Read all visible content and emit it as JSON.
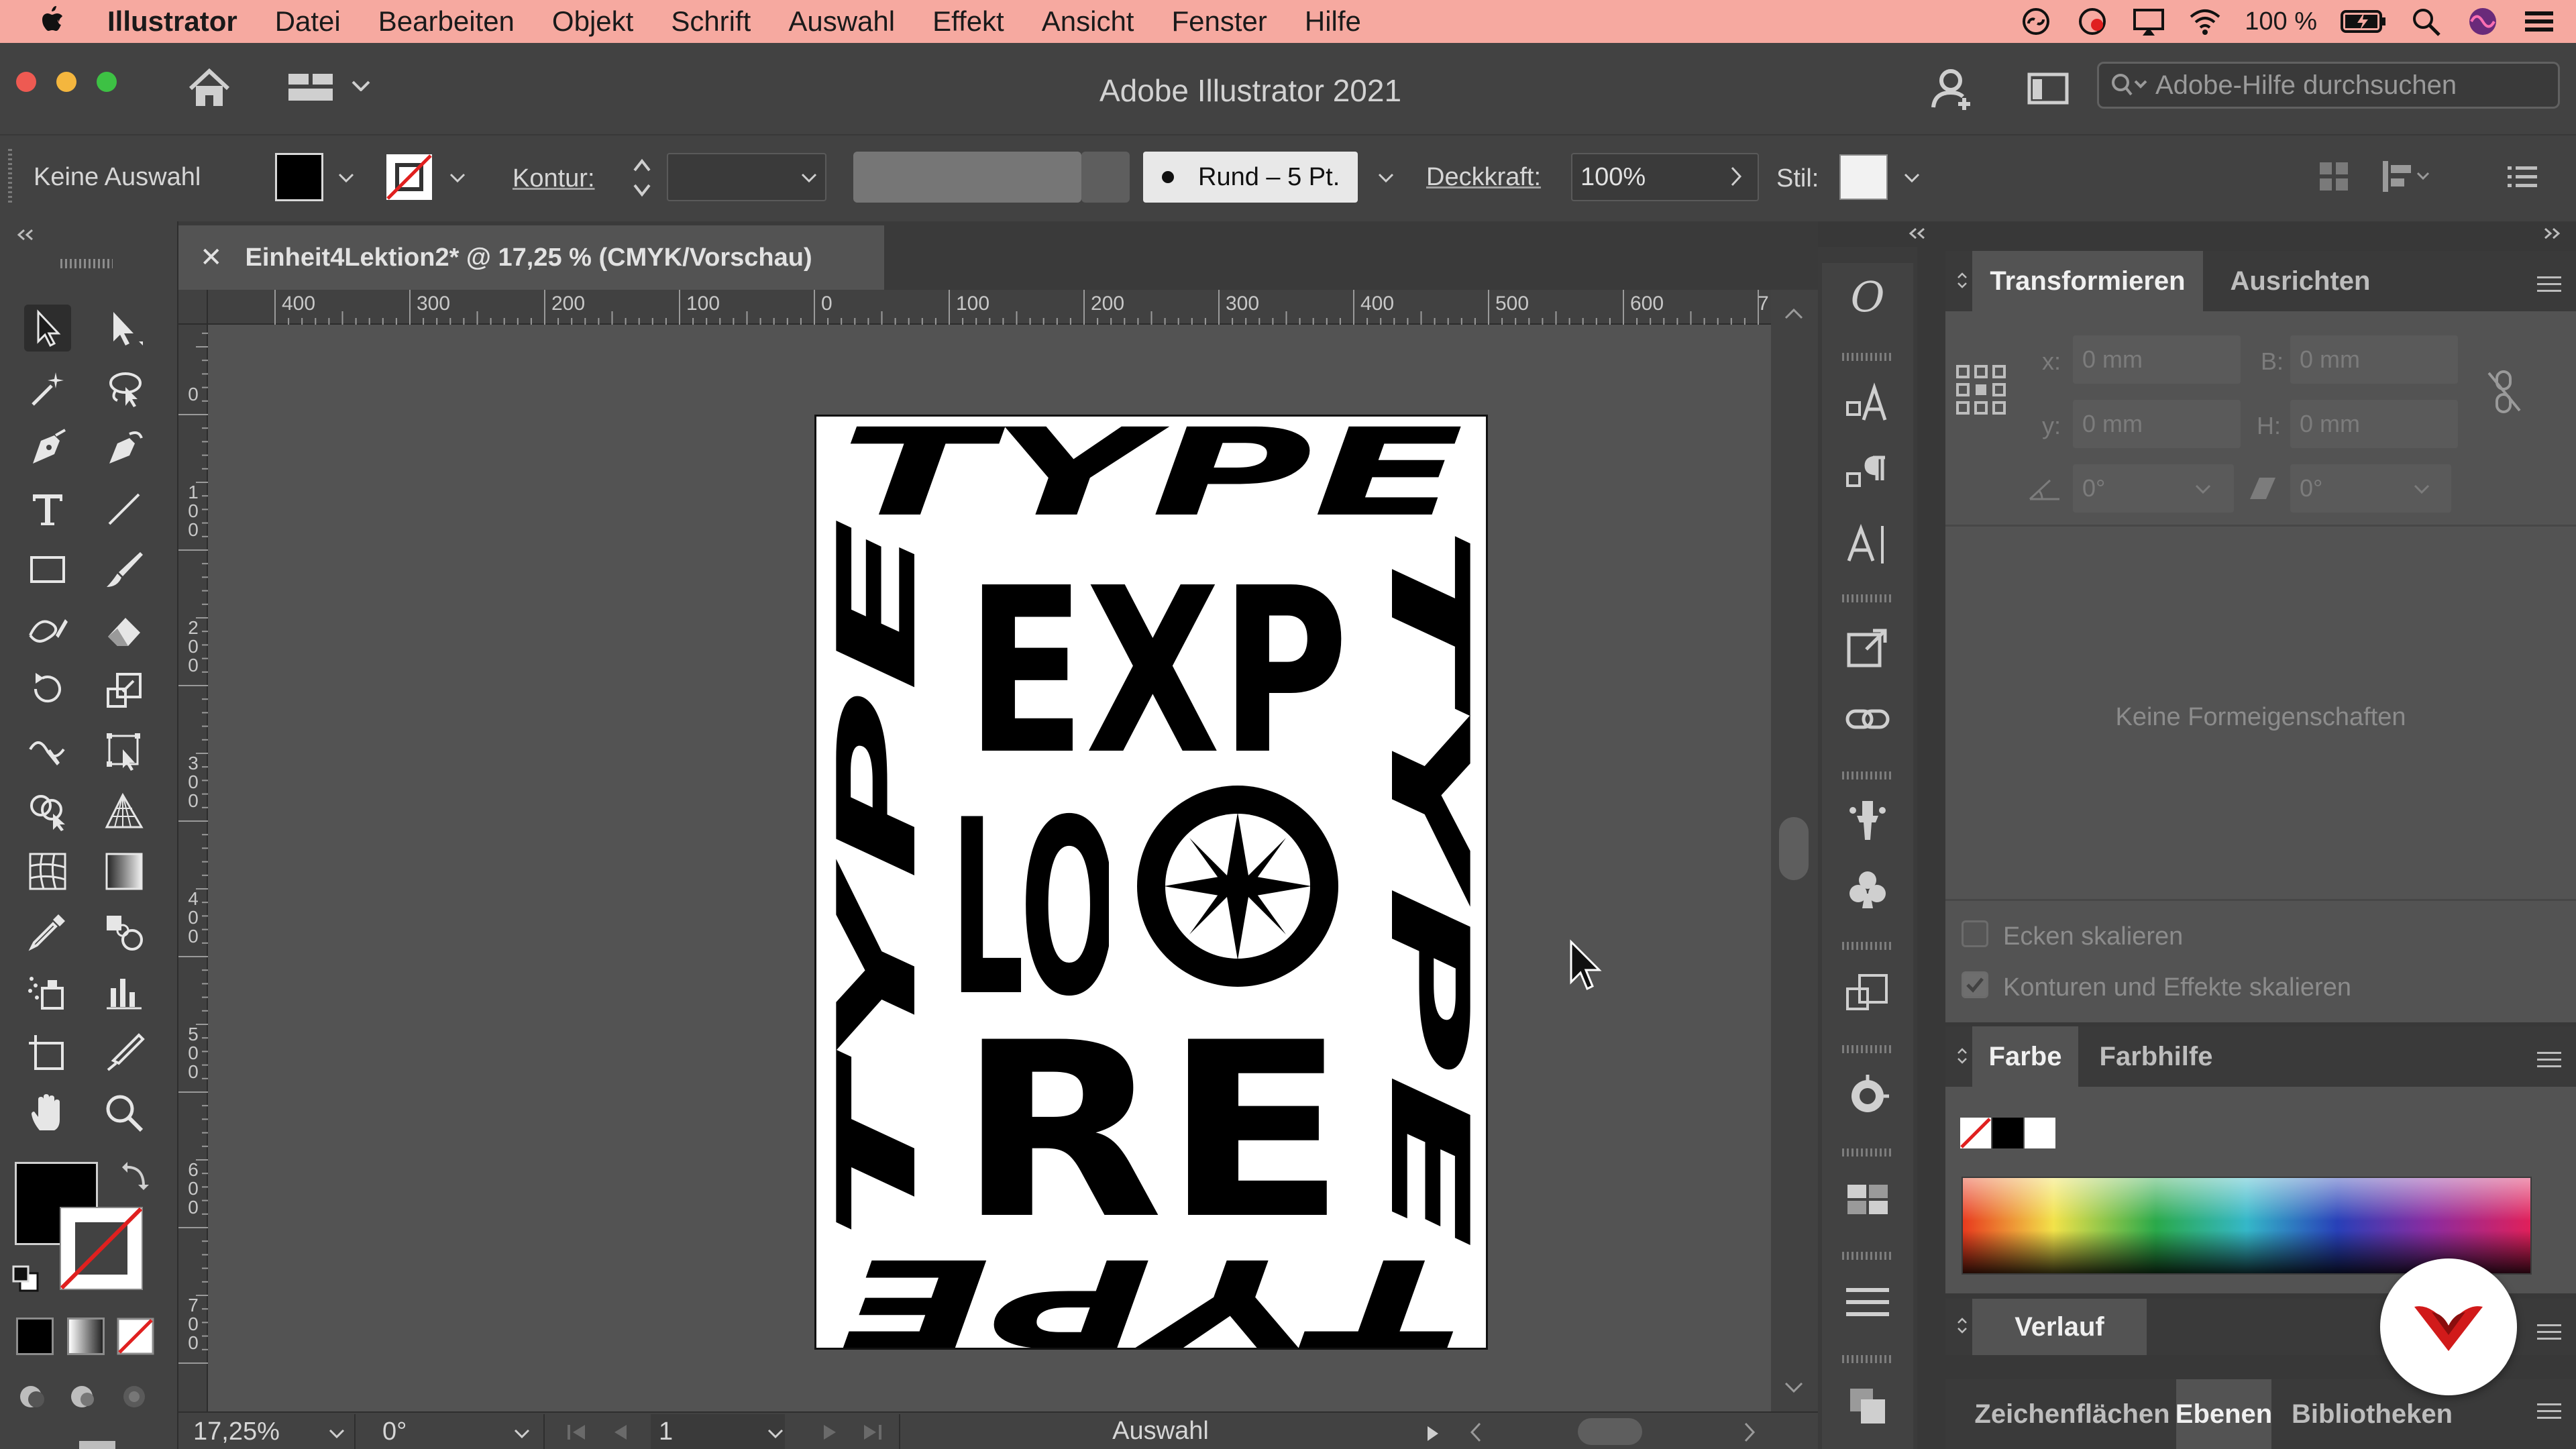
{
  "menubar": {
    "app_name": "Illustrator",
    "items": [
      "Datei",
      "Bearbeiten",
      "Objekt",
      "Schrift",
      "Auswahl",
      "Effekt",
      "Ansicht",
      "Fenster",
      "Hilfe"
    ],
    "battery": "100 %",
    "color": "#f6a9a0"
  },
  "titlebar": {
    "title": "Adobe Illustrator 2021",
    "help_search_placeholder": "Adobe-Hilfe durchsuchen"
  },
  "controlbar": {
    "selection": "Keine Auswahl",
    "stroke_label": "Kontur:",
    "brush": "Rund – 5 Pt.",
    "opacity_label": "Deckkraft:",
    "opacity_value": "100%",
    "style_label": "Stil:"
  },
  "document": {
    "tab_title": "Einheit4Lektion2* @ 17,25 % (CMYK/Vorschau)"
  },
  "rulers": {
    "top": [
      "400",
      "300",
      "200",
      "100",
      "0",
      "100",
      "200",
      "300",
      "400",
      "500",
      "600",
      "7"
    ],
    "left": [
      "0",
      "100",
      "200",
      "300",
      "400",
      "500",
      "600",
      "700"
    ]
  },
  "artwork": {
    "top_text": "TYPE",
    "bottom_text": "TYPE",
    "left_text": "TYPE",
    "right_text": "TYPE",
    "center_lines": [
      "EXP",
      "LO",
      "RE"
    ]
  },
  "statusbar": {
    "zoom": "17,25%",
    "rotation": "0°",
    "artboard_number": "1",
    "tool_name": "Auswahl"
  },
  "transform_panel": {
    "tab_active": "Transformieren",
    "tab_inactive": "Ausrichten",
    "x_label": "x:",
    "x_value": "0 mm",
    "y_label": "y:",
    "y_value": "0 mm",
    "w_label": "B:",
    "w_value": "0 mm",
    "h_label": "H:",
    "h_value": "0 mm",
    "angle_value": "0°",
    "shear_value": "0°",
    "no_shape_props": "Keine Formeigenschaften",
    "scale_corners": "Ecken skalieren",
    "scale_strokes": "Konturen und Effekte skalieren"
  },
  "color_panel": {
    "tab_active": "Farbe",
    "tab_inactive": "Farbhilfe"
  },
  "gradient_panel": {
    "title": "Verlauf"
  },
  "bottom_tabs": {
    "artboards": "Zeichenflächen",
    "layers": "Ebenen",
    "libraries": "Bibliotheken"
  }
}
